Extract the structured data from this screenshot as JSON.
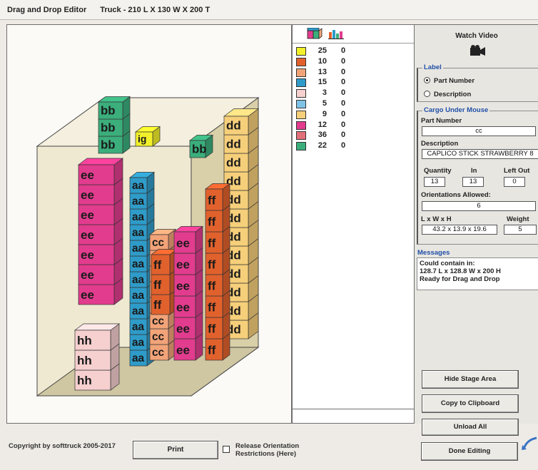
{
  "window": {
    "title": "Drag and Drop Editor",
    "truck": "Truck - 210 L X 130 W X 200 T"
  },
  "legend": {
    "items": [
      {
        "color": "#f2f02a",
        "qty": "25",
        "remaining": "0"
      },
      {
        "color": "#e1612d",
        "qty": "10",
        "remaining": "0"
      },
      {
        "color": "#f2a378",
        "qty": "13",
        "remaining": "0"
      },
      {
        "color": "#2f9bc8",
        "qty": "15",
        "remaining": "0"
      },
      {
        "color": "#f6cfcf",
        "qty": "3",
        "remaining": "0"
      },
      {
        "color": "#7fc2e8",
        "qty": "5",
        "remaining": "0"
      },
      {
        "color": "#f6cf7a",
        "qty": "9",
        "remaining": "0"
      },
      {
        "color": "#e23c8e",
        "qty": "12",
        "remaining": "0"
      },
      {
        "color": "#e2707a",
        "qty": "36",
        "remaining": "0"
      },
      {
        "color": "#3bae7c",
        "qty": "22",
        "remaining": "0"
      }
    ]
  },
  "watch_video": "Watch Video",
  "label_group": {
    "title": "Label",
    "options": [
      "Part Number",
      "Description"
    ],
    "selected": "Part Number"
  },
  "cargo": {
    "title": "Cargo Under Mouse",
    "part_number_label": "Part Number",
    "part_number": "cc",
    "description_label": "Description",
    "description": "CAPLICO STICK STRAWBERRY 8",
    "quantity_label": "Quantity",
    "quantity": "13",
    "in_label": "In",
    "in": "13",
    "left_out_label": "Left Out",
    "left_out": "0",
    "orientations_label": "Orientations Allowed:",
    "orientations": "6",
    "lwh_label": "L x W x H",
    "lwh": "43.2 x 13.9 x 19.6",
    "weight_label": "Weight",
    "weight": "5"
  },
  "messages": {
    "title": "Messages",
    "lines": [
      "Could contain in:",
      "128.7 L x 128.8 W x 200 H",
      "Ready for Drag and Drop"
    ]
  },
  "buttons": {
    "hide_stage": "Hide Stage Area",
    "copy": "Copy to Clipboard",
    "unload": "Unload All",
    "done": "Done Editing",
    "print": "Print"
  },
  "footer": {
    "copyright": "Copyright by softtruck 2005-2017",
    "release_label": "Release Orientation Restrictions (Here)"
  },
  "cargo_columns": [
    {
      "label": "hh",
      "color": "#f6cfcf",
      "count": 3
    },
    {
      "label": "ee",
      "color": "#e23c8e",
      "count": 7
    },
    {
      "label": "aa",
      "color": "#2f9bc8",
      "count": 12
    },
    {
      "label": "cc",
      "color": "#f2a378",
      "count": 8
    },
    {
      "label": "ff",
      "color": "#e1612d",
      "count": 3
    },
    {
      "label": "ee",
      "color": "#e23c8e",
      "count": 6
    },
    {
      "label": "ff",
      "color": "#e1612d",
      "count": 8
    },
    {
      "label": "bb",
      "color": "#3bae7c",
      "count": 3
    },
    {
      "label": "bb",
      "color": "#3bae7c",
      "count": 1
    },
    {
      "label": "ig",
      "color": "#f2f02a",
      "count": 1
    },
    {
      "label": "dd",
      "color": "#f6cf7a",
      "count": 12
    }
  ]
}
